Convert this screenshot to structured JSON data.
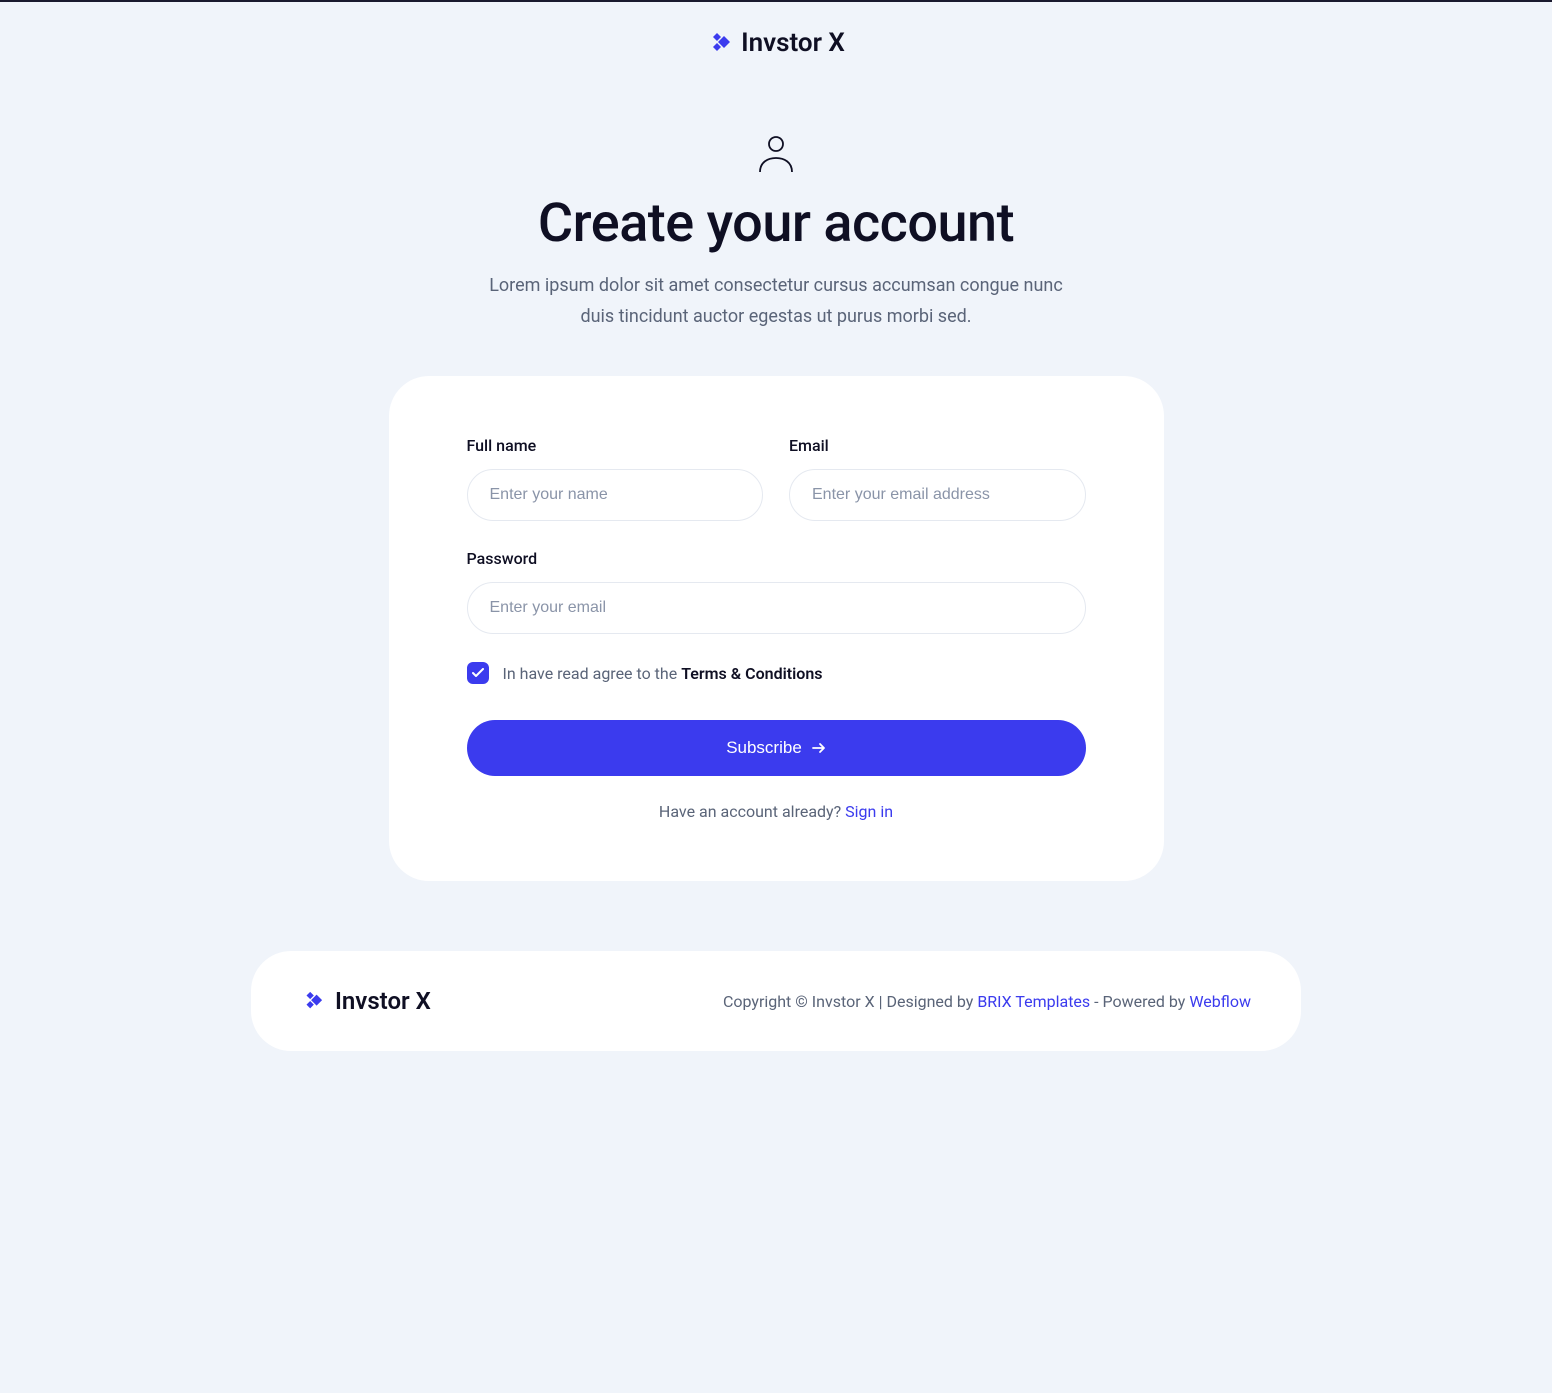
{
  "brand": {
    "name": "Invstor X"
  },
  "hero": {
    "title": "Create your account",
    "subtitle": "Lorem ipsum dolor sit amet consectetur cursus accumsan congue nunc duis tincidunt auctor egestas ut purus morbi sed."
  },
  "form": {
    "fullname": {
      "label": "Full name",
      "placeholder": "Enter your name"
    },
    "email": {
      "label": "Email",
      "placeholder": "Enter your email address"
    },
    "password": {
      "label": "Password",
      "placeholder": "Enter your email"
    },
    "terms": {
      "prefix": "In have read agree to the ",
      "link": "Terms & Conditions"
    },
    "submit": "Subscribe",
    "signin": {
      "prefix": "Have an account already? ",
      "link": "Sign in"
    }
  },
  "footer": {
    "copyright_prefix": "Copyright © Invstor X | Designed by ",
    "designer": "BRIX Templates",
    "powered_prefix": " - Powered by ",
    "platform": "Webflow"
  }
}
